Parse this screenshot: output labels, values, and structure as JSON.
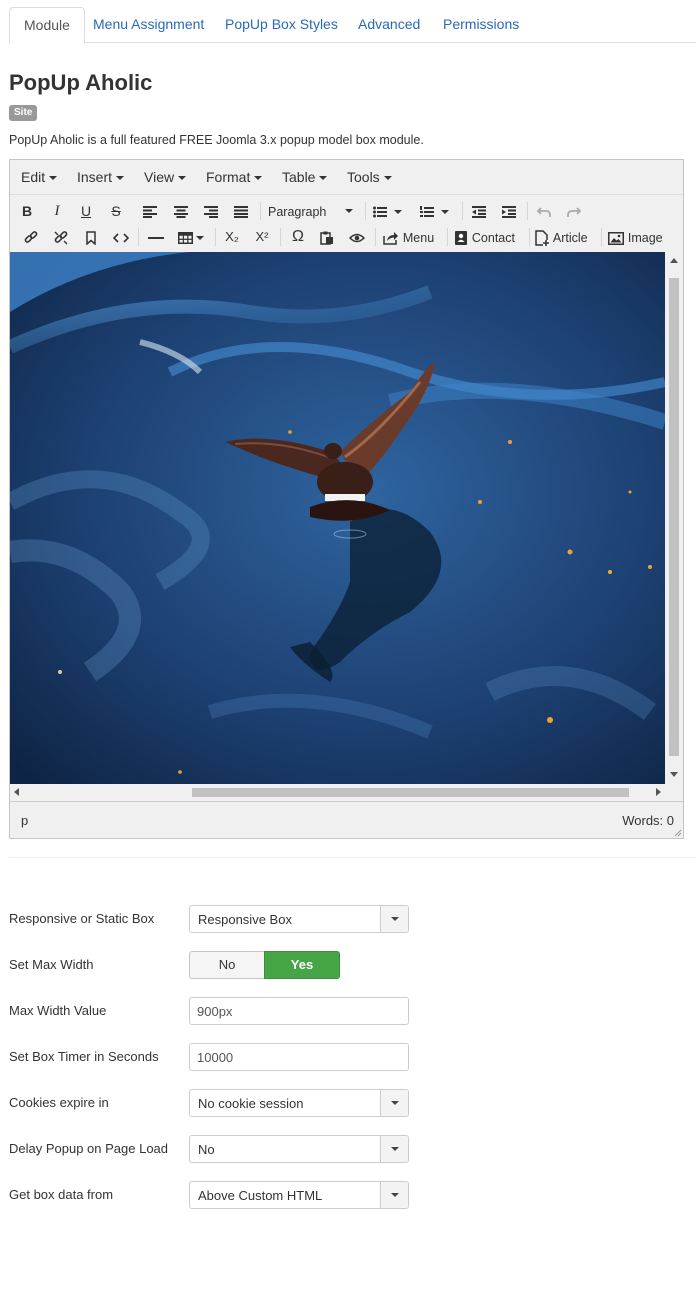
{
  "tabs": [
    {
      "label": "Module",
      "active": true
    },
    {
      "label": "Menu Assignment"
    },
    {
      "label": "PopUp Box Styles"
    },
    {
      "label": "Advanced"
    },
    {
      "label": "Permissions"
    }
  ],
  "module": {
    "title": "PopUp Aholic",
    "badge": "Site",
    "description": "PopUp Aholic is a full featured FREE Joomla 3.x popup model box module."
  },
  "editor": {
    "menus": [
      "Edit",
      "Insert",
      "View",
      "Format",
      "Table",
      "Tools"
    ],
    "format_select": "Paragraph",
    "buttons": {
      "menu": "Menu",
      "contact": "Contact",
      "article": "Article",
      "image": "Image"
    },
    "icons": {
      "bold": "B",
      "italic": "I",
      "underline": "U",
      "strike": "S",
      "special_char": "Ω",
      "subscript": "X₂",
      "superscript": "X²"
    },
    "status": {
      "path": "p",
      "words": "Words: 0"
    }
  },
  "form": {
    "responsive": {
      "label": "Responsive or Static Box",
      "value": "Responsive Box"
    },
    "max_width": {
      "label": "Set Max Width",
      "no": "No",
      "yes": "Yes",
      "selected": "Yes"
    },
    "max_width_value": {
      "label": "Max Width Value",
      "value": "900px"
    },
    "timer": {
      "label": "Set Box Timer in Seconds",
      "value": "10000"
    },
    "cookies": {
      "label": "Cookies expire in",
      "value": "No cookie session"
    },
    "delay": {
      "label": "Delay Popup on Page Load",
      "value": "No"
    },
    "box_data": {
      "label": "Get box data from",
      "value": "Above Custom HTML"
    }
  },
  "colors": {
    "link": "#2a69b8",
    "toggle_yes": "#46a546",
    "badge": "#999999"
  }
}
